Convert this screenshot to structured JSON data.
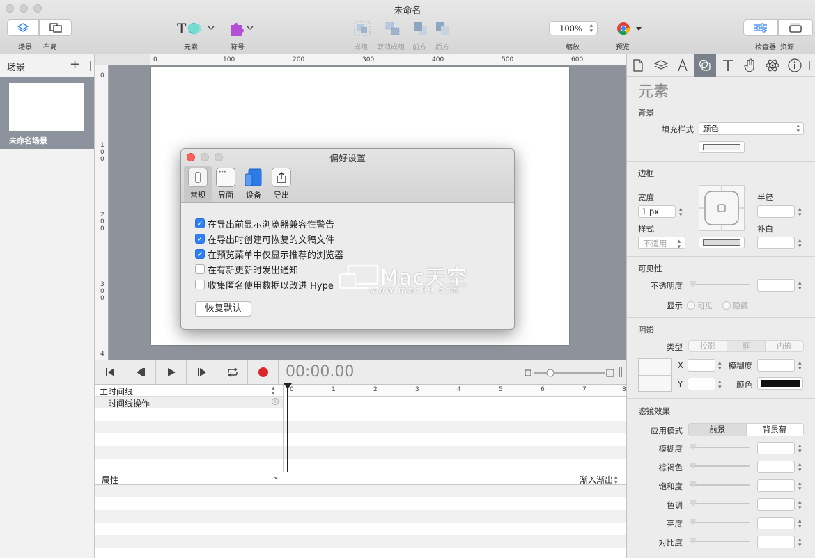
{
  "window": {
    "title": "未命名"
  },
  "toolbar": {
    "scenes_label": "场景",
    "layout_label": "布局",
    "elements_label": "元素",
    "symbols_label": "符号",
    "group_label": "成组",
    "ungroup_label": "取消成组",
    "front_label": "前方",
    "back_label": "后方",
    "zoom_value": "100%",
    "zoom_label": "缩放",
    "preview_label": "预览",
    "inspector_label": "检查器",
    "resources_label": "资源"
  },
  "scenes": {
    "header": "场景",
    "add": "+",
    "items": [
      {
        "name": "未命名场景"
      }
    ]
  },
  "rulers": {
    "top": [
      "0",
      "100",
      "200",
      "300",
      "400",
      "500",
      "600"
    ],
    "left": [
      "0",
      "100",
      "200",
      "300",
      "4"
    ]
  },
  "timeline": {
    "time": "00:00.00",
    "main_timeline": "主时间线",
    "timeline_actions": "时间线操作",
    "properties": "属性",
    "easing": "渐入渐出",
    "ticks": [
      "0",
      "1",
      "2",
      "3",
      "4",
      "5",
      "6",
      "7",
      "8"
    ]
  },
  "inspector": {
    "title": "元素",
    "background": {
      "header": "背景",
      "fill_label": "填充样式",
      "fill_value": "颜色"
    },
    "border": {
      "header": "边框",
      "width_label": "宽度",
      "width_value": "1 px",
      "style_label": "样式",
      "style_value": "不适用",
      "radius_label": "半径",
      "padding_label": "补白"
    },
    "visibility": {
      "header": "可见性",
      "opacity_label": "不透明度",
      "display_label": "显示",
      "visible": "可见",
      "hidden": "隐藏"
    },
    "shadow": {
      "header": "阴影",
      "type_label": "类型",
      "types": [
        "投影",
        "框",
        "内嵌"
      ],
      "x": "X",
      "y": "Y",
      "blur_label": "模糊度",
      "color_label": "颜色"
    },
    "filters": {
      "header": "滤镜效果",
      "mode_label": "应用模式",
      "modes": [
        "前景",
        "背景幕"
      ],
      "rows": [
        "模糊度",
        "棕褐色",
        "饱和度",
        "色调",
        "亮度",
        "对比度"
      ]
    }
  },
  "dialog": {
    "title": "偏好设置",
    "tabs": [
      "常规",
      "界面",
      "设备",
      "导出"
    ],
    "options": [
      {
        "label": "在导出前显示浏览器兼容性警告",
        "checked": true
      },
      {
        "label": "在导出时创建可恢复的文稿文件",
        "checked": true
      },
      {
        "label": "在预览菜单中仅显示推荐的浏览器",
        "checked": true
      },
      {
        "label": "在有新更新时发出通知",
        "checked": false
      },
      {
        "label": "收集匿名使用数据以改进 Hype",
        "checked": false
      }
    ],
    "reset_button": "恢复默认"
  },
  "watermark": {
    "brand": "Mac天空",
    "url": "www.mac69.com"
  },
  "colors": {
    "accent": "#2f7ff5",
    "record": "#d9262c",
    "canvas": "#8e939b",
    "scene_selected": "#8d939c"
  }
}
